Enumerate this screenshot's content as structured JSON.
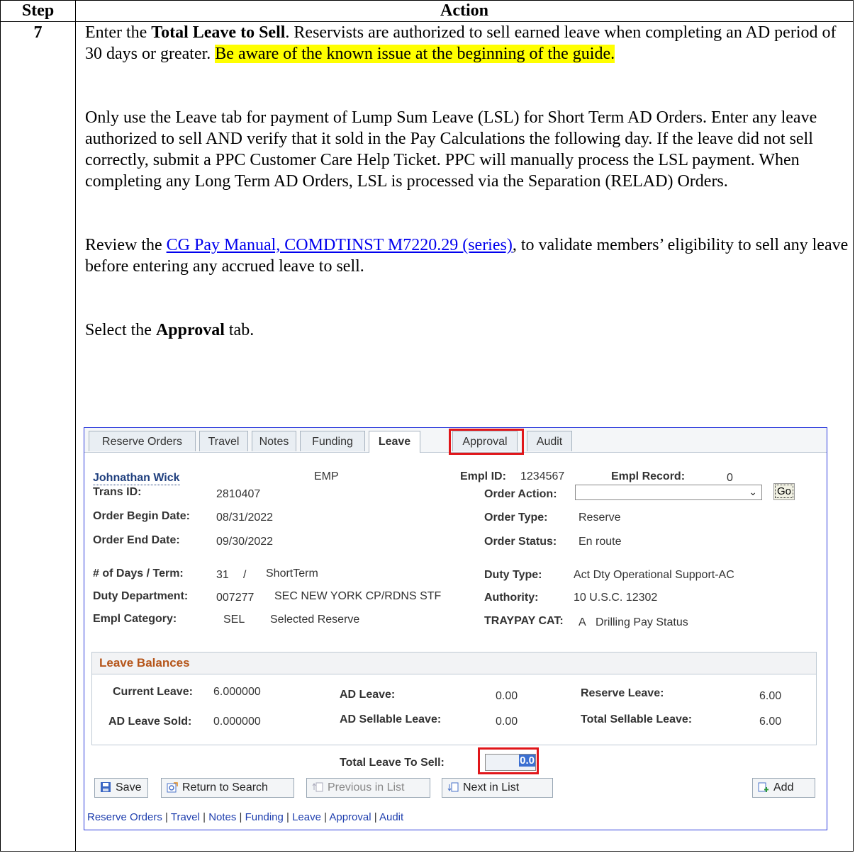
{
  "table": {
    "header_step": "Step",
    "header_action": "Action",
    "step_number": "7"
  },
  "instructions": {
    "p1_pre": "Enter the ",
    "p1_bold": "Total Leave to Sell",
    "p1_mid": ". Reservists are authorized to sell earned leave when completing an AD period of 30 days or greater. ",
    "p1_highlight": "Be aware of the known issue at the beginning of the guide.",
    "p2": "Only use the Leave tab for payment of Lump Sum Leave (LSL) for Short Term AD Orders. Enter any leave authorized to sell AND verify that it sold in the Pay Calculations the following day. If the leave did not sell correctly, submit a PPC Customer Care Help Ticket. PPC will manually process the LSL payment. When completing any Long Term AD Orders, LSL is processed via the Separation (RELAD) Orders.",
    "p3_pre": "Review the ",
    "p3_link": "CG Pay Manual, COMDTINST M7220.29 (series)",
    "p3_post": ", to validate members’ eligibility to sell any leave before entering any accrued leave to sell.",
    "p4_pre": "Select the ",
    "p4_bold": "Approval",
    "p4_post": " tab."
  },
  "tabs": [
    {
      "label": "Reserve Orders"
    },
    {
      "label": "Travel"
    },
    {
      "label": "Notes"
    },
    {
      "label": "Funding"
    },
    {
      "label": "Leave"
    },
    {
      "label": "Approval"
    },
    {
      "label": "Audit"
    }
  ],
  "employee": {
    "name": "Johnathan Wick",
    "type": "EMP",
    "empl_id_label": "Empl ID:",
    "empl_id": "1234567",
    "empl_record_label": "Empl Record:",
    "empl_record": "0"
  },
  "fields": {
    "trans_id_label": "Trans ID:",
    "trans_id": "2810407",
    "order_action_label": "Order Action:",
    "order_action_value": "",
    "go_label": "Go",
    "begin_label": "Order Begin Date:",
    "begin": "08/31/2022",
    "order_type_label": "Order Type:",
    "order_type": "Reserve",
    "end_label": "Order End Date:",
    "end": "09/30/2022",
    "order_status_label": "Order Status:",
    "order_status": "En route",
    "days_term_label": "# of Days / Term:",
    "days": "31",
    "days_sep": "/",
    "term": "ShortTerm",
    "duty_type_label": "Duty Type:",
    "duty_type": "Act Dty Operational Support-AC",
    "duty_dept_label": "Duty Department:",
    "duty_dept_code": "007277",
    "duty_dept_name": "SEC NEW YORK CP/RDNS STF",
    "authority_label": "Authority:",
    "authority": "10 U.S.C. 12302",
    "empl_cat_label": "Empl Category:",
    "empl_cat_code": "SEL",
    "empl_cat_name": "Selected Reserve",
    "traypay_label": "TRAYPAY CAT:",
    "traypay_code": "A",
    "traypay_name": "Drilling Pay Status"
  },
  "leave_balances": {
    "title": "Leave Balances",
    "current_label": "Current Leave:",
    "current": "6.000000",
    "ad_leave_label": "AD Leave:",
    "ad_leave": "0.00",
    "reserve_label": "Reserve Leave:",
    "reserve": "6.00",
    "ad_sold_label": "AD Leave Sold:",
    "ad_sold": "0.000000",
    "ad_sellable_label": "AD Sellable Leave:",
    "ad_sellable": "0.00",
    "total_sellable_label": "Total Sellable Leave:",
    "total_sellable": "6.00"
  },
  "total_to_sell": {
    "label": "Total Leave To Sell:",
    "value": "0.0"
  },
  "buttons": {
    "save": "Save",
    "return": "Return to Search",
    "previous": "Previous in List",
    "next": "Next in List",
    "add": "Add"
  },
  "bottom_links": [
    "Reserve Orders",
    "Travel",
    "Notes",
    "Funding",
    "Leave",
    "Approval",
    "Audit"
  ],
  "colors": {
    "highlight": "#ffff00",
    "callout": "#e0161a",
    "panel_border": "#2c3bdc",
    "link": "#0000ee"
  }
}
